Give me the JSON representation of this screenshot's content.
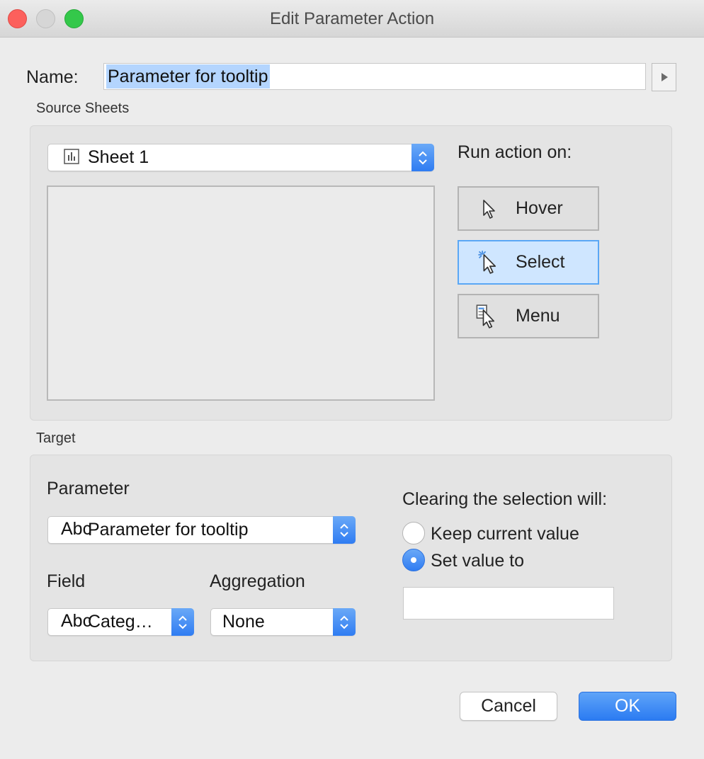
{
  "window": {
    "title": "Edit Parameter Action"
  },
  "name": {
    "label": "Name:",
    "value": "Parameter for tooltip"
  },
  "source": {
    "section_label": "Source Sheets",
    "sheet_select": {
      "value": "Sheet 1",
      "icon": "bar-chart-icon"
    },
    "run_action": {
      "label": "Run action on:",
      "options": [
        {
          "label": "Hover",
          "icon": "hover-cursor-icon",
          "active": false
        },
        {
          "label": "Select",
          "icon": "select-cursor-icon",
          "active": true
        },
        {
          "label": "Menu",
          "icon": "menu-cursor-icon",
          "active": false
        }
      ]
    }
  },
  "target": {
    "section_label": "Target",
    "parameter": {
      "label": "Parameter",
      "type_badge": "Abc",
      "value": "Parameter for tooltip"
    },
    "field": {
      "label": "Field",
      "type_badge": "Abc",
      "value": "Categ…"
    },
    "aggregation": {
      "label": "Aggregation",
      "value": "None"
    },
    "clearing": {
      "label": "Clearing the selection will:",
      "options": [
        {
          "label": "Keep current value",
          "checked": false
        },
        {
          "label": "Set value to",
          "checked": true
        }
      ],
      "set_value": ""
    }
  },
  "buttons": {
    "cancel": "Cancel",
    "ok": "OK"
  },
  "colors": {
    "accent": "#2f7cf2",
    "active_bg": "#cfe6ff",
    "selection": "#b4d5fe"
  }
}
